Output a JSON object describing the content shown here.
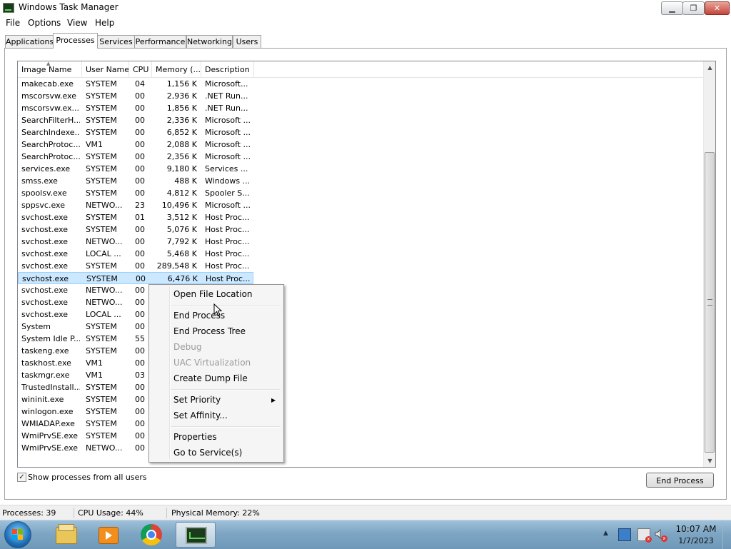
{
  "window": {
    "title": "Windows Task Manager",
    "min_glyph": "▁",
    "max_glyph": "❐",
    "close_glyph": "✕"
  },
  "menu": [
    "File",
    "Options",
    "View",
    "Help"
  ],
  "tabs": [
    "Applications",
    "Processes",
    "Services",
    "Performance",
    "Networking",
    "Users"
  ],
  "active_tab": "Processes",
  "columns": [
    "Image Name",
    "User Name",
    "CPU",
    "Memory (...",
    "Description"
  ],
  "processes": [
    {
      "name": "makecab.exe",
      "user": "SYSTEM",
      "cpu": "04",
      "mem": "1,156 K",
      "desc": "Microsoft..."
    },
    {
      "name": "mscorsvw.exe",
      "user": "SYSTEM",
      "cpu": "00",
      "mem": "2,936 K",
      "desc": ".NET Run..."
    },
    {
      "name": "mscorsvw.ex...",
      "user": "SYSTEM",
      "cpu": "00",
      "mem": "1,856 K",
      "desc": ".NET Run..."
    },
    {
      "name": "SearchFilterH...",
      "user": "SYSTEM",
      "cpu": "00",
      "mem": "2,336 K",
      "desc": "Microsoft ..."
    },
    {
      "name": "SearchIndexe...",
      "user": "SYSTEM",
      "cpu": "00",
      "mem": "6,852 K",
      "desc": "Microsoft ..."
    },
    {
      "name": "SearchProtoc...",
      "user": "VM1",
      "cpu": "00",
      "mem": "2,088 K",
      "desc": "Microsoft ..."
    },
    {
      "name": "SearchProtoc...",
      "user": "SYSTEM",
      "cpu": "00",
      "mem": "2,356 K",
      "desc": "Microsoft ..."
    },
    {
      "name": "services.exe",
      "user": "SYSTEM",
      "cpu": "00",
      "mem": "9,180 K",
      "desc": "Services ..."
    },
    {
      "name": "smss.exe",
      "user": "SYSTEM",
      "cpu": "00",
      "mem": "488 K",
      "desc": "Windows ..."
    },
    {
      "name": "spoolsv.exe",
      "user": "SYSTEM",
      "cpu": "00",
      "mem": "4,812 K",
      "desc": "Spooler S..."
    },
    {
      "name": "sppsvc.exe",
      "user": "NETWO...",
      "cpu": "23",
      "mem": "10,496 K",
      "desc": "Microsoft ..."
    },
    {
      "name": "svchost.exe",
      "user": "SYSTEM",
      "cpu": "01",
      "mem": "3,512 K",
      "desc": "Host Proc..."
    },
    {
      "name": "svchost.exe",
      "user": "SYSTEM",
      "cpu": "00",
      "mem": "5,076 K",
      "desc": "Host Proc..."
    },
    {
      "name": "svchost.exe",
      "user": "NETWO...",
      "cpu": "00",
      "mem": "7,792 K",
      "desc": "Host Proc..."
    },
    {
      "name": "svchost.exe",
      "user": "LOCAL ...",
      "cpu": "00",
      "mem": "5,468 K",
      "desc": "Host Proc..."
    },
    {
      "name": "svchost.exe",
      "user": "SYSTEM",
      "cpu": "00",
      "mem": "289,548 K",
      "desc": "Host Proc..."
    },
    {
      "name": "svchost.exe",
      "user": "SYSTEM",
      "cpu": "00",
      "mem": "6,476 K",
      "desc": "Host Proc...",
      "selected": true
    },
    {
      "name": "svchost.exe",
      "user": "NETWO...",
      "cpu": "00",
      "mem": "",
      "desc": ""
    },
    {
      "name": "svchost.exe",
      "user": "NETWO...",
      "cpu": "00",
      "mem": "",
      "desc": ""
    },
    {
      "name": "svchost.exe",
      "user": "LOCAL ...",
      "cpu": "00",
      "mem": "",
      "desc": ""
    },
    {
      "name": "System",
      "user": "SYSTEM",
      "cpu": "00",
      "mem": "",
      "desc": ""
    },
    {
      "name": "System Idle P...",
      "user": "SYSTEM",
      "cpu": "55",
      "mem": "",
      "desc": ""
    },
    {
      "name": "taskeng.exe",
      "user": "SYSTEM",
      "cpu": "00",
      "mem": "",
      "desc": ""
    },
    {
      "name": "taskhost.exe",
      "user": "VM1",
      "cpu": "00",
      "mem": "",
      "desc": ""
    },
    {
      "name": "taskmgr.exe",
      "user": "VM1",
      "cpu": "03",
      "mem": "",
      "desc": ""
    },
    {
      "name": "TrustedInstall...",
      "user": "SYSTEM",
      "cpu": "00",
      "mem": "",
      "desc": ""
    },
    {
      "name": "wininit.exe",
      "user": "SYSTEM",
      "cpu": "00",
      "mem": "",
      "desc": ""
    },
    {
      "name": "winlogon.exe",
      "user": "SYSTEM",
      "cpu": "00",
      "mem": "",
      "desc": ""
    },
    {
      "name": "WMIADAP.exe",
      "user": "SYSTEM",
      "cpu": "00",
      "mem": "",
      "desc": ""
    },
    {
      "name": "WmiPrvSE.exe",
      "user": "SYSTEM",
      "cpu": "00",
      "mem": "",
      "desc": ""
    },
    {
      "name": "WmiPrvSE.exe",
      "user": "NETWO...",
      "cpu": "00",
      "mem": "",
      "desc": ""
    }
  ],
  "show_all_users": {
    "label": "Show processes from all users",
    "checked": true,
    "check_glyph": "✓"
  },
  "end_process_button": "End Process",
  "context_menu": {
    "items": [
      {
        "label": "Open File Location"
      },
      {
        "label": "End Process"
      },
      {
        "label": "End Process Tree"
      },
      {
        "label": "Debug",
        "disabled": true
      },
      {
        "label": "UAC Virtualization",
        "disabled": true
      },
      {
        "label": "Create Dump File"
      },
      {
        "label": "Set Priority",
        "submenu": true
      },
      {
        "label": "Set Affinity..."
      },
      {
        "label": "Properties"
      },
      {
        "label": "Go to Service(s)"
      }
    ],
    "submenu_glyph": "▶"
  },
  "status": {
    "processes": "Processes: 39",
    "cpu": "CPU Usage: 44%",
    "memory": "Physical Memory: 22%"
  },
  "scrollbar": {
    "up_glyph": "▲",
    "down_glyph": "▼"
  },
  "taskbar": {
    "pinned_icons": [
      "windows-explorer-icon",
      "windows-media-player-icon",
      "chrome-icon",
      "task-manager-icon"
    ],
    "tray_chevron": "▲",
    "time": "10:07 AM",
    "date": "1/7/2023"
  },
  "colors": {
    "selection": "#cce8ff",
    "selection_border": "#99d1ff",
    "taskbar": "#7ea6c4",
    "close_button": "#c5443a"
  }
}
